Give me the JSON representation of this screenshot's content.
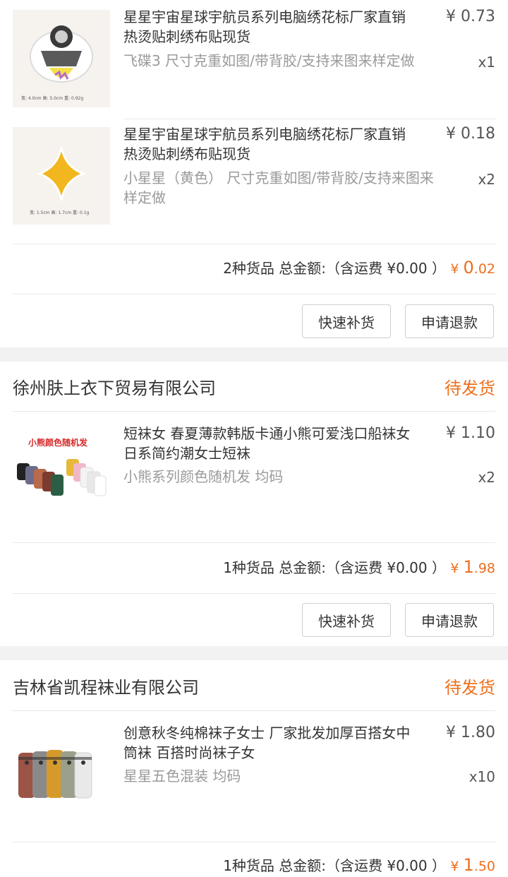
{
  "orders": [
    {
      "items": [
        {
          "title_line1": "星星宇宙星球宇航员系列电脑绣花标厂家直销",
          "title_line2": "热烫贴刺绣布贴现货",
          "spec_line1": "飞碟3 尺寸克重如图/带背胶/支持来图来样定做",
          "spec_line2": "",
          "price": "¥ 0.73",
          "qty": "x1",
          "thumb_caption": "宽: 4.0cm 高: 5.0cm 重: 0.92g"
        },
        {
          "title_line1": "星星宇宙星球宇航员系列电脑绣花标厂家直销",
          "title_line2": "热烫贴刺绣布贴现货",
          "spec_line1": "小星星（黄色） 尺寸克重如图/带背胶/支持来图来",
          "spec_line2": "样定做",
          "price": "¥ 0.18",
          "qty": "x2",
          "thumb_caption": "宽: 1.5cm 高: 1.7cm 重: 0.1g"
        }
      ],
      "summary": "2种货品 总金额:（含运费 ¥0.00 ）",
      "total_currency": "¥ ",
      "total_int": "0",
      "total_dec": ".02",
      "buttons": [
        "快速补货",
        "申请退款"
      ]
    },
    {
      "shop": "徐州肤上衣下贸易有限公司",
      "status": "待发货",
      "items": [
        {
          "title_line1": "短袜女 春夏薄款韩版卡通小熊可爱浅口船袜女",
          "title_line2": "日系简约潮女士短袜",
          "spec_line1": "小熊系列颜色随机发 均码",
          "spec_line2": "",
          "price": "¥ 1.10",
          "qty": "x2",
          "thumb_caption": "小熊颜色随机发"
        }
      ],
      "summary": "1种货品 总金额:（含运费 ¥0.00 ）",
      "total_currency": "¥ ",
      "total_int": "1",
      "total_dec": ".98",
      "buttons": [
        "快速补货",
        "申请退款"
      ]
    },
    {
      "shop": "吉林省凯程袜业有限公司",
      "status": "待发货",
      "items": [
        {
          "title_line1": "创意秋冬纯棉袜子女士 厂家批发加厚百搭女中",
          "title_line2": "筒袜 百搭时尚袜子女",
          "spec_line1": "星星五色混装 均码",
          "spec_line2": "",
          "price": "¥ 1.80",
          "qty": "x10"
        }
      ],
      "summary": "1种货品 总金额:（含运费 ¥0.00 ）",
      "total_currency": "¥ ",
      "total_int": "1",
      "total_dec": ".50"
    }
  ],
  "colors": {
    "accent": "#ee6f1d",
    "text": "#333333",
    "muted": "#9a9a9a",
    "divider": "#e8e8e8",
    "section_gap": "#f2f2f2"
  },
  "icons": [
    "ufo-astronaut-patch-image",
    "yellow-star-patch-image",
    "bear-socks-image",
    "striped-socks-image"
  ]
}
